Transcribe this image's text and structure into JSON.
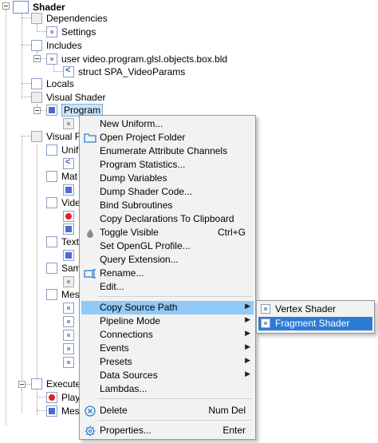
{
  "tree": {
    "root": "Shader",
    "dependencies": "Dependencies",
    "settings": "Settings",
    "includes": "Includes",
    "include_file": "user video.program.glsl.objects.box.bld",
    "struct": "struct SPA_VideoParams",
    "locals": "Locals",
    "visual_shader": "Visual Shader",
    "program": "Program",
    "visual_r": "Visual Re",
    "unif": "Unif",
    "mat": "Mat",
    "vide": "Vide",
    "text": "Text",
    "sam": "Sam",
    "mes": "Mes",
    "execute": "Execute",
    "play": "Play",
    "mes2": "Mes"
  },
  "menu": {
    "items": [
      {
        "label": "New Uniform...",
        "shortcut": "",
        "icon": "",
        "arrow": false
      },
      {
        "label": "Open Project Folder",
        "shortcut": "",
        "icon": "folder-icon",
        "arrow": false
      },
      {
        "label": "Enumerate Attribute Channels",
        "shortcut": "",
        "icon": "",
        "arrow": false
      },
      {
        "label": "Program Statistics...",
        "shortcut": "",
        "icon": "",
        "arrow": false
      },
      {
        "label": "Dump Variables",
        "shortcut": "",
        "icon": "",
        "arrow": false
      },
      {
        "label": "Dump Shader Code...",
        "shortcut": "",
        "icon": "",
        "arrow": false
      },
      {
        "label": "Bind Subroutines",
        "shortcut": "",
        "icon": "",
        "arrow": false
      },
      {
        "label": "Copy Declarations To Clipboard",
        "shortcut": "",
        "icon": "",
        "arrow": false
      },
      {
        "label": "Toggle Visible",
        "shortcut": "Ctrl+G",
        "icon": "drop-icon",
        "arrow": false
      },
      {
        "label": "Set OpenGL Profile...",
        "shortcut": "",
        "icon": "",
        "arrow": false
      },
      {
        "label": "Query Extension...",
        "shortcut": "",
        "icon": "",
        "arrow": false
      },
      {
        "label": "Rename...",
        "shortcut": "",
        "icon": "rename-icon",
        "arrow": false
      },
      {
        "label": "Edit...",
        "shortcut": "",
        "icon": "",
        "arrow": false
      },
      {
        "label": "Copy Source Path",
        "shortcut": "",
        "icon": "",
        "arrow": true
      },
      {
        "label": "Pipeline Mode",
        "shortcut": "",
        "icon": "",
        "arrow": true
      },
      {
        "label": "Connections",
        "shortcut": "",
        "icon": "",
        "arrow": true
      },
      {
        "label": "Events",
        "shortcut": "",
        "icon": "",
        "arrow": true
      },
      {
        "label": "Presets",
        "shortcut": "",
        "icon": "",
        "arrow": true
      },
      {
        "label": "Data Sources",
        "shortcut": "",
        "icon": "",
        "arrow": true
      },
      {
        "label": "Lambdas...",
        "shortcut": "",
        "icon": "",
        "arrow": false
      },
      {
        "label": "Delete",
        "shortcut": "Num Del",
        "icon": "delete-icon",
        "arrow": false
      },
      {
        "label": "Properties...",
        "shortcut": "Enter",
        "icon": "gear-icon",
        "arrow": false
      }
    ]
  },
  "submenu": {
    "items": [
      "Vertex Shader",
      "Fragment Shader"
    ]
  },
  "colors": {
    "menu_bg": "#f2f2f2",
    "menu_highlight": "#91c9f7",
    "submenu_highlight": "#2e7bd6",
    "selection_bg": "#cde4f7"
  }
}
